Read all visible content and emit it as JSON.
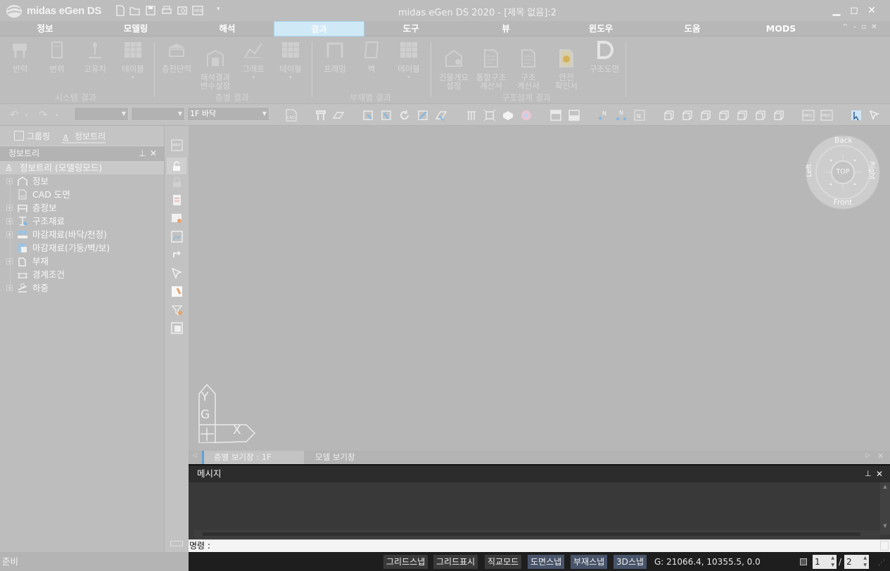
{
  "app": {
    "name": "midas eGen DS",
    "window_title": "midas eGen DS 2020 - [제목 없음]:2"
  },
  "menu": [
    "정보",
    "모델링",
    "해석",
    "결과",
    "도구",
    "뷰",
    "윈도우",
    "도움",
    "MODS"
  ],
  "active_menu": "결과",
  "ribbon": {
    "groups": [
      {
        "label": "시스템 결과",
        "buttons": [
          "반력",
          "변위",
          "고유치",
          "테이블"
        ]
      },
      {
        "label": "층별 결과",
        "buttons": [
          "층전단력",
          "해석결과\n변수설정",
          "그래프",
          "테이블"
        ]
      },
      {
        "label": "부재별 결과",
        "buttons": [
          "프레임",
          "벽",
          "테이블"
        ]
      },
      {
        "label": "구조설계 결과",
        "buttons": [
          "건물개요\n설정",
          "통합구조\n계산서",
          "구조\n계산서",
          "안전\n확인서",
          "구조도면"
        ]
      }
    ]
  },
  "toolbar": {
    "floor_combo": "1F 바닥"
  },
  "left_panel": {
    "tabs": [
      "그룹핑",
      "정보트리"
    ],
    "active_tab": "정보트리",
    "title": "정보트리",
    "tree": [
      {
        "label": "정보트리 (모델링모드)",
        "expandable": false,
        "root": true
      },
      {
        "label": "정보",
        "expandable": true
      },
      {
        "label": "CAD 도면",
        "expandable": false
      },
      {
        "label": "층정보",
        "expandable": true
      },
      {
        "label": "구조재료",
        "expandable": true
      },
      {
        "label": "마감재료(바닥/천정)",
        "expandable": true
      },
      {
        "label": "마감재료(기둥/벽/보)",
        "expandable": false
      },
      {
        "label": "부재",
        "expandable": true
      },
      {
        "label": "경계조건",
        "expandable": false
      },
      {
        "label": "하중",
        "expandable": true
      }
    ]
  },
  "view_cube": {
    "back": "Back",
    "front": "Front",
    "left": "Left",
    "right": "Right",
    "top": "TOP"
  },
  "axis": {
    "y": "Y",
    "g": "G",
    "x": "X"
  },
  "view_tabs": [
    "층별 보기창 : 1F",
    "모델 보기창"
  ],
  "message": {
    "title": "메시지",
    "command_label": "명령 :"
  },
  "status": {
    "ready": "준비",
    "toggles": [
      {
        "label": "그리드스냅",
        "on": false
      },
      {
        "label": "그리드표시",
        "on": false
      },
      {
        "label": "직교모드",
        "on": false
      },
      {
        "label": "도면스냅",
        "on": true
      },
      {
        "label": "부재스냅",
        "on": true
      },
      {
        "label": "3D스냅",
        "on": true
      }
    ],
    "coords": "G: 21066.4, 10355.5, 0.0",
    "page": "1",
    "page_sep": "/",
    "page_total": "2"
  },
  "colors": {
    "ui_gray": "#bdbdbd",
    "active_tab": "#cfe9f7",
    "message_bg": "#393939",
    "status_on": "#48546a"
  }
}
